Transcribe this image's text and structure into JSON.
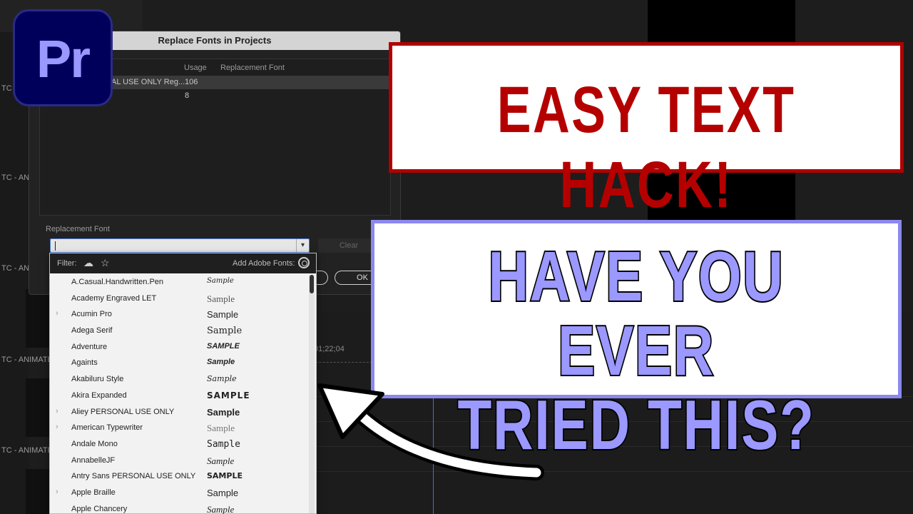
{
  "logo": {
    "text": "Pr"
  },
  "background": {
    "labels": [
      "TC -",
      "TC - ANI",
      "TC - AN",
      "TC - ANIMATE",
      "TC - ANIMATE"
    ],
    "timecode": "01;22;04"
  },
  "dialog": {
    "title": "Replace Fonts in Projects",
    "columns": {
      "usage": "Usage",
      "replacement": "Replacement Font"
    },
    "rows": [
      {
        "font": "AL USE ONLY Reg...",
        "usage": "106"
      },
      {
        "font": "",
        "usage": "8"
      }
    ],
    "replacement_label": "Replacement Font",
    "input_value": "",
    "clear_label": "Clear",
    "ok_label": "OK"
  },
  "popup": {
    "filter_label": "Filter:",
    "add_fonts_label": "Add Adobe Fonts:",
    "fonts": [
      {
        "name": "A.Casual.Handwritten.Pen",
        "sample": "Sample",
        "expandable": false
      },
      {
        "name": "Academy Engraved LET",
        "sample": "Sample",
        "expandable": false
      },
      {
        "name": "Acumin Pro",
        "sample": "Sample",
        "expandable": true
      },
      {
        "name": "Adega Serif",
        "sample": "Sample",
        "expandable": false
      },
      {
        "name": "Adventure",
        "sample": "SAMPLE",
        "expandable": false
      },
      {
        "name": "Againts",
        "sample": "Sample",
        "expandable": false
      },
      {
        "name": "Akabiluru Style",
        "sample": "Sample",
        "expandable": false
      },
      {
        "name": "Akira Expanded",
        "sample": "SAMPLE",
        "expandable": false
      },
      {
        "name": "Aliey PERSONAL USE ONLY",
        "sample": "Sample",
        "expandable": true
      },
      {
        "name": "American Typewriter",
        "sample": "Sample",
        "expandable": true
      },
      {
        "name": "Andale Mono",
        "sample": "Sample",
        "expandable": false
      },
      {
        "name": "AnnabelleJF",
        "sample": "Sample",
        "expandable": false
      },
      {
        "name": "Antry Sans PERSONAL USE ONLY",
        "sample": "SAMPLE",
        "expandable": false
      },
      {
        "name": "Apple Braille",
        "sample": "Sample",
        "expandable": true
      },
      {
        "name": "Apple Chancery",
        "sample": "Sample",
        "expandable": false
      }
    ]
  },
  "overlay": {
    "headline": "EASY TEXT HACK!",
    "question_line1": "HAVE YOU EVER",
    "question_line2": "TRIED THIS?"
  },
  "colors": {
    "headline_red": "#b50000",
    "question_purple": "#9b98ff",
    "premiere_bg": "#00005b",
    "premiere_text": "#9999ff"
  }
}
